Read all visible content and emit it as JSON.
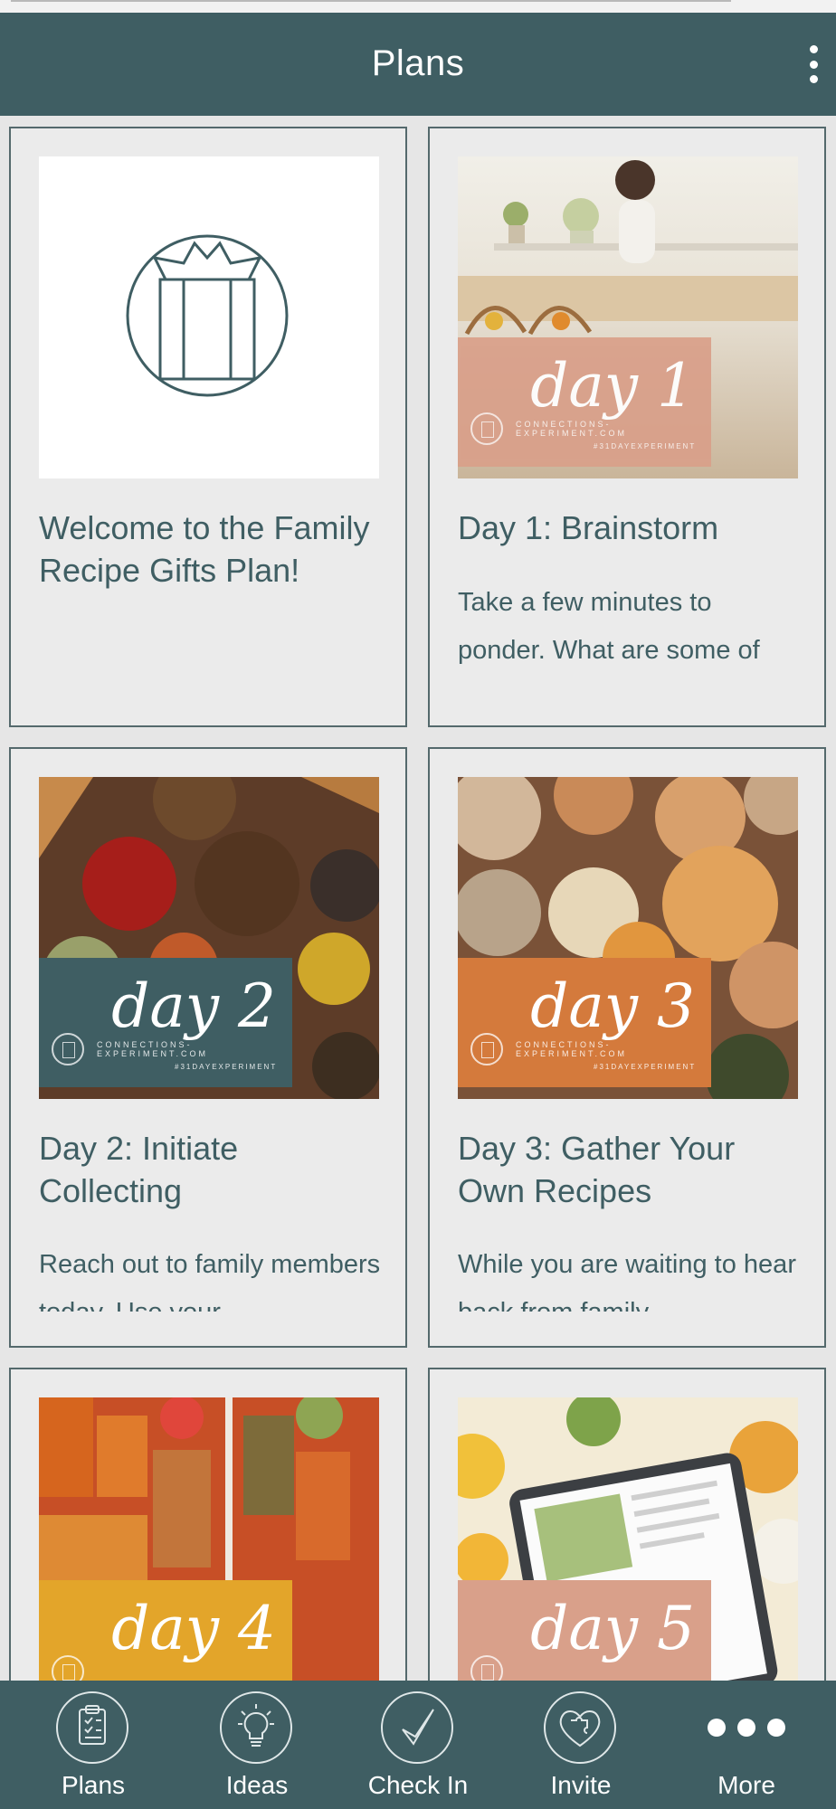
{
  "header": {
    "title": "Plans"
  },
  "cards": [
    {
      "title": "Welcome to the Family Recipe Gifts Plan!",
      "description": ""
    },
    {
      "title": "Day 1: Brainstorm",
      "description": "Take a few minutes to ponder. What are some of your family's favorite",
      "day_text": "day 1",
      "badge_color": "#d9a08a"
    },
    {
      "title": "Day 2: Initiate Collecting",
      "description": "Reach out to family members today. Use your",
      "day_text": "day 2",
      "badge_color": "#3f5e63"
    },
    {
      "title": "Day 3: Gather Your Own Recipes",
      "description": "While you are waiting to hear back from family",
      "day_text": "day 3",
      "badge_color": "#d47a3c"
    },
    {
      "title": "",
      "description": "",
      "day_text": "day 4",
      "badge_color": "#e3a52a"
    },
    {
      "title": "",
      "description": "",
      "day_text": "day 5",
      "badge_color": "#d9a08a"
    }
  ],
  "badge_site_text": "CONNECTIONS-EXPERIMENT.COM",
  "badge_tag_text": "#31DAYEXPERIMENT",
  "tabbar": {
    "items": [
      {
        "label": "Plans",
        "icon": "clipboard-icon"
      },
      {
        "label": "Ideas",
        "icon": "lightbulb-icon"
      },
      {
        "label": "Check In",
        "icon": "checkmark-icon"
      },
      {
        "label": "Invite",
        "icon": "heart-puzzle-icon"
      },
      {
        "label": "More",
        "icon": "more-dots-icon"
      }
    ]
  },
  "colors": {
    "primary": "#3f5e63",
    "background": "#e6e6e6",
    "card_border": "#54696c"
  }
}
